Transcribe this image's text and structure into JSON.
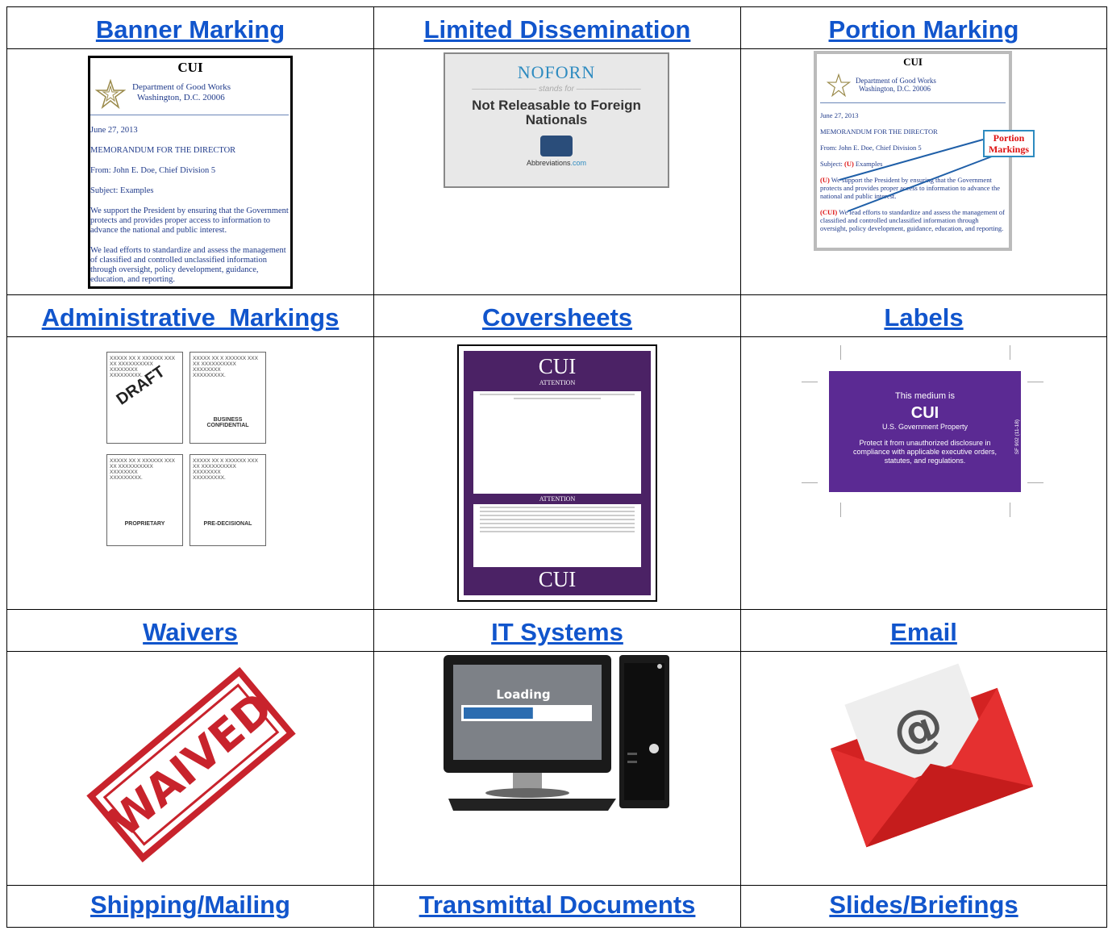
{
  "headers": {
    "row1": [
      "Banner Marking",
      "Limited Dissemination",
      "Portion Marking"
    ],
    "row2": [
      "Administrative  Markings",
      "Coversheets",
      "Labels"
    ],
    "row3": [
      "Waivers",
      "IT Systems",
      "Email"
    ],
    "row4": [
      "Shipping/Mailing",
      "Transmittal Documents",
      "Slides/Briefings"
    ]
  },
  "banner_memo": {
    "cui": "CUI",
    "dept_line1": "Department of  Good Works",
    "dept_line2": "Washington, D.C. 20006",
    "date": "June 27, 2013",
    "memo_for": "MEMORANDUM FOR THE DIRECTOR",
    "from": "From:  John E. Doe, Chief Division 5",
    "subject": "Subject:  Examples",
    "para1": "We support the President by ensuring that the Government protects and provides proper access to information to advance the national and public interest.",
    "para2": "We lead efforts to standardize and assess the management of classified and controlled unclassified information through oversight, policy development, guidance, education, and reporting."
  },
  "noforn": {
    "title": "NOFORN",
    "stands_for": "stands for",
    "meaning": "Not Releasable to Foreign Nationals",
    "site_a": "Abbreviations",
    "site_b": ".com"
  },
  "portion_memo": {
    "cui": "CUI",
    "dept_line1": "Department of Good Works",
    "dept_line2": "Washington, D.C. 20006",
    "date": "June 27, 2013",
    "memo_for": "MEMORANDUM FOR THE DIRECTOR",
    "from": "From:  John E. Doe, Chief Division 5",
    "subject_pre": "Subject:  ",
    "subject_mark": "(U)",
    "subject_post": " Examples",
    "p1_mark": "(U)",
    "p1_text": " We support the President by ensuring that the Government protects and provides proper access to information to advance the national and public interest.",
    "p2_mark": "(CUI)",
    "p2_text": " We lead efforts to standardize and assess the management of classified and controlled unclassified information through oversight, policy development, guidance, education, and reporting.",
    "callout_line1": "Portion",
    "callout_line2": "Markings"
  },
  "admin": {
    "x_lines": [
      "XXXXX  XX  X  XXXXXX  XXX",
      "XX  XXXXXXXXXX",
      "XXXXXXXX",
      "XXXXXXXXX."
    ],
    "draft": "DRAFT",
    "biz1": "BUSINESS",
    "biz2": "CONFIDENTIAL",
    "proprietary": "PROPRIETARY",
    "predecisional": "PRE-DECISIONAL"
  },
  "coversheet": {
    "cui_top": "CUI",
    "attention_top": "ATTENTION",
    "attention_bottom": "ATTENTION",
    "cui_bottom": "CUI"
  },
  "label": {
    "line1": "This medium is",
    "cui": "CUI",
    "property": "U.S. Government Property",
    "protect": "Protect it from unauthorized disclosure in compliance with applicable executive orders, statutes, and regulations.",
    "form": "SF 902 (11-18)"
  },
  "waived": {
    "stamp": "WAIVED"
  },
  "it_systems": {
    "loading": "Loading",
    "progress": 0.55
  },
  "email": {
    "symbol": "@"
  }
}
